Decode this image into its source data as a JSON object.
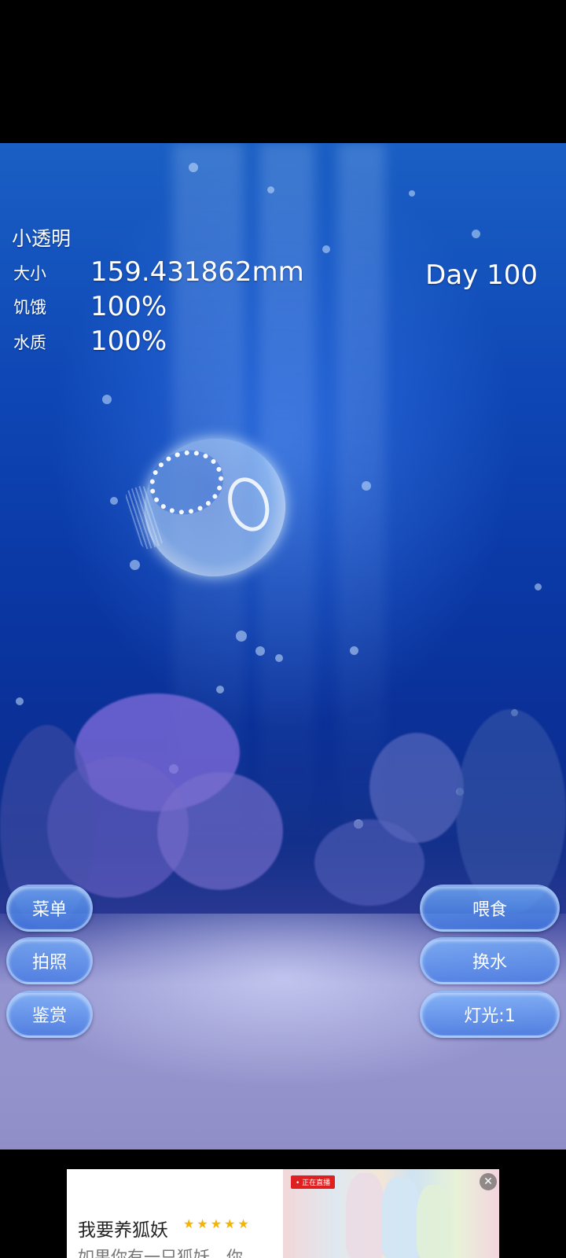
{
  "pet": {
    "name": "小透明",
    "stats": [
      {
        "label": "大小",
        "value": "159.431862mm"
      },
      {
        "label": "饥饿",
        "value": "100%"
      },
      {
        "label": "水质",
        "value": "100%"
      }
    ],
    "day": "Day 100"
  },
  "buttons": {
    "menu": "菜单",
    "photo": "拍照",
    "appreciate": "鉴赏",
    "feed": "喂食",
    "change_water": "换水",
    "light": "灯光:1"
  },
  "ad": {
    "title": "我要养狐妖",
    "stars": "★★★★★",
    "description": "如果你有一只狐妖，你",
    "live_badge": "• 正在直播",
    "close_icon": "close-icon"
  },
  "colors": {
    "water_top": "#1a5fc4",
    "water_deep": "#0b2f95",
    "button_fill": "#5a9cf0"
  }
}
